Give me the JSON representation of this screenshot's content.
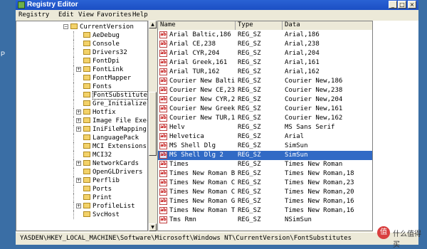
{
  "window": {
    "title": "Registry Editor"
  },
  "menubar": {
    "items": [
      "Registry",
      "Edit",
      "View",
      "Favorites",
      "Help"
    ]
  },
  "background": {
    "left_edge_text": "P"
  },
  "tree": {
    "items": [
      {
        "label": "CurrentVersion",
        "level": 0,
        "expanded": true
      },
      {
        "label": "AeDebug",
        "level": 1,
        "expander": false
      },
      {
        "label": "Console",
        "level": 1,
        "expander": false
      },
      {
        "label": "Drivers32",
        "level": 1,
        "expander": false
      },
      {
        "label": "FontDpi",
        "level": 1,
        "expander": false
      },
      {
        "label": "FontLink",
        "level": 1,
        "expander": true
      },
      {
        "label": "FontMapper",
        "level": 1,
        "expander": false
      },
      {
        "label": "Fonts",
        "level": 1,
        "expander": false
      },
      {
        "label": "FontSubstitutes",
        "level": 1,
        "expander": false,
        "selected": true
      },
      {
        "label": "Gre_Initialize",
        "level": 1,
        "expander": false
      },
      {
        "label": "Hotfix",
        "level": 1,
        "expander": true
      },
      {
        "label": "Image File Exec",
        "level": 1,
        "expander": true
      },
      {
        "label": "IniFileMapping",
        "level": 1,
        "expander": true
      },
      {
        "label": "LanguagePack",
        "level": 1,
        "expander": false
      },
      {
        "label": "MCI Extensions",
        "level": 1,
        "expander": false
      },
      {
        "label": "MCI32",
        "level": 1,
        "expander": false
      },
      {
        "label": "NetworkCards",
        "level": 1,
        "expander": true
      },
      {
        "label": "OpenGLDrivers",
        "level": 1,
        "expander": false
      },
      {
        "label": "Perflib",
        "level": 1,
        "expander": true
      },
      {
        "label": "Ports",
        "level": 1,
        "expander": false
      },
      {
        "label": "Print",
        "level": 1,
        "expander": false
      },
      {
        "label": "ProfileList",
        "level": 1,
        "expander": true
      },
      {
        "label": "SvcHost",
        "level": 1,
        "expander": false
      }
    ]
  },
  "list": {
    "columns": [
      "Name",
      "Type",
      "Data"
    ],
    "rows": [
      {
        "name": "Arial Baltic,186",
        "type": "REG_SZ",
        "data": "Arial,186"
      },
      {
        "name": "Arial CE,238",
        "type": "REG_SZ",
        "data": "Arial,238"
      },
      {
        "name": "Arial CYR,204",
        "type": "REG_SZ",
        "data": "Arial,204"
      },
      {
        "name": "Arial Greek,161",
        "type": "REG_SZ",
        "data": "Arial,161"
      },
      {
        "name": "Arial TUR,162",
        "type": "REG_SZ",
        "data": "Arial,162"
      },
      {
        "name": "Courier New Balti...",
        "type": "REG_SZ",
        "data": "Courier New,186"
      },
      {
        "name": "Courier New CE,238",
        "type": "REG_SZ",
        "data": "Courier New,238"
      },
      {
        "name": "Courier New CYR,204",
        "type": "REG_SZ",
        "data": "Courier New,204"
      },
      {
        "name": "Courier New Greek...",
        "type": "REG_SZ",
        "data": "Courier New,161"
      },
      {
        "name": "Courier New TUR,162",
        "type": "REG_SZ",
        "data": "Courier New,162"
      },
      {
        "name": "Helv",
        "type": "REG_SZ",
        "data": "MS Sans Serif"
      },
      {
        "name": "Helvetica",
        "type": "REG_SZ",
        "data": "Arial"
      },
      {
        "name": "MS Shell Dlg",
        "type": "REG_SZ",
        "data": "SimSun"
      },
      {
        "name": "MS Shell Dlg 2",
        "type": "REG_SZ",
        "data": "SimSun",
        "selected": true
      },
      {
        "name": "Times",
        "type": "REG_SZ",
        "data": "Times New Roman"
      },
      {
        "name": "Times New Roman B...",
        "type": "REG_SZ",
        "data": "Times New Roman,18"
      },
      {
        "name": "Times New Roman C...",
        "type": "REG_SZ",
        "data": "Times New Roman,23"
      },
      {
        "name": "Times New Roman C...",
        "type": "REG_SZ",
        "data": "Times New Roman,20"
      },
      {
        "name": "Times New Roman G...",
        "type": "REG_SZ",
        "data": "Times New Roman,16"
      },
      {
        "name": "Times New Roman T...",
        "type": "REG_SZ",
        "data": "Times New Roman,16"
      },
      {
        "name": "Tms Rmn",
        "type": "REG_SZ",
        "data": "NSimSun"
      }
    ]
  },
  "statusbar": {
    "path": "YASDEN\\HKEY_LOCAL_MACHINE\\Software\\Microsoft\\Windows NT\\CurrentVersion\\FontSubstitutes"
  },
  "watermark": {
    "glyph": "值",
    "text": "什么值得买"
  }
}
